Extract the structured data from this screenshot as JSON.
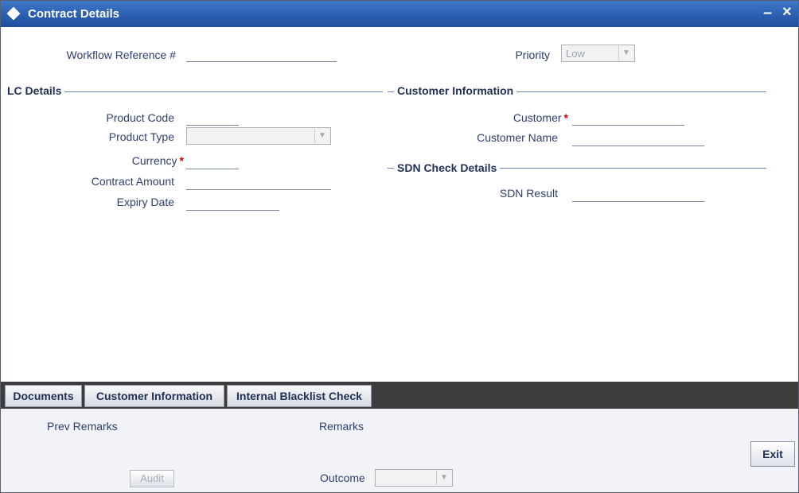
{
  "window": {
    "title": "Contract Details",
    "minimize": "–",
    "close": "×"
  },
  "header": {
    "workflow_ref_label": "Workflow Reference #",
    "workflow_ref_value": "",
    "priority_label": "Priority",
    "priority_value": "Low"
  },
  "lc_details": {
    "section_title": "LC Details",
    "product_code_label": "Product Code",
    "product_type_label": "Product Type",
    "currency_label": "Currency",
    "contract_amount_label": "Contract Amount",
    "expiry_date_label": "Expiry Date"
  },
  "customer_info": {
    "section_title": "Customer Information",
    "customer_label": "Customer",
    "customer_name_label": "Customer Name"
  },
  "sdn": {
    "section_title": "SDN Check Details",
    "sdn_result_label": "SDN Result"
  },
  "required_marker": "*",
  "tabs": [
    "Documents",
    "Customer Information",
    "Internal Blacklist Check"
  ],
  "footer": {
    "prev_remarks_label": "Prev Remarks",
    "remarks_label": "Remarks",
    "audit_button": "Audit",
    "outcome_label": "Outcome",
    "outcome_value": "",
    "exit_button": "Exit"
  },
  "colors": {
    "titlebar": "#2b5fb0",
    "required": "#d40000",
    "tabbar": "#3c3c3c"
  },
  "icons": {
    "title": "diamond-icon",
    "dropdown": "chevron-down-icon"
  }
}
